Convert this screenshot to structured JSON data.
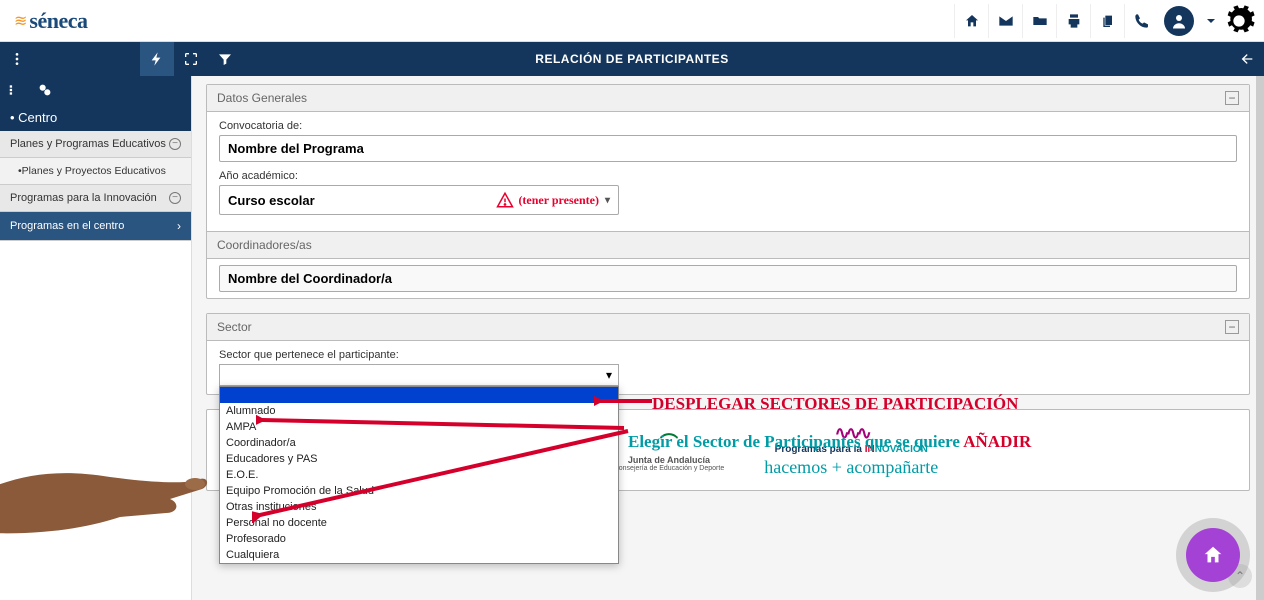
{
  "app": {
    "logo_text": "séneca"
  },
  "top_icons": {
    "home": "home-icon",
    "mail": "mail-icon",
    "folder": "folder-icon",
    "print": "print-icon",
    "copy": "copy-icon",
    "phone": "phone-icon",
    "user": "user-avatar-icon",
    "chevron": "chevron-down-icon",
    "gear": "gear-icon"
  },
  "navy": {
    "menu": "menu-icon",
    "bolt": "bolt-icon",
    "expand": "expand-icon",
    "filter": "filter-icon",
    "title": "RELACIÓN DE PARTICIPANTES",
    "back": "back-icon"
  },
  "sidebar": {
    "section_head": "• Centro",
    "items": [
      {
        "label": "Planes y Programas Educativos",
        "chev": "−",
        "type": "collapse"
      },
      {
        "label": "•Planes y Proyectos Educativos",
        "sub": true
      },
      {
        "label": "Programas para la Innovación",
        "chev": "−",
        "type": "collapse"
      },
      {
        "label": "Programas en el centro",
        "active": true,
        "chev": "›"
      }
    ]
  },
  "panels": {
    "datos": {
      "title": "Datos Generales",
      "conv_label": "Convocatoria de:",
      "conv_value": "Nombre del Programa",
      "ano_label": "Año académico:",
      "ano_value": "Curso escolar",
      "warning": "(tener presente)",
      "coord_title": "Coordinadores/as",
      "coord_value": "Nombre del Coordinador/a"
    },
    "sector": {
      "title": "Sector",
      "field_label": "Sector que pertenece el participante:",
      "options": [
        "",
        "Alumnado",
        "AMPA",
        "Coordinador/a",
        "Educadores y PAS",
        "E.O.E.",
        "Equipo Promoción de la Salud",
        "Otras instituciones",
        "Personal no docente",
        "Profesorado",
        "Cualquiera"
      ]
    }
  },
  "annotations": {
    "a1": "DESPLEGAR SECTORES DE PARTICIPACIÓN",
    "a2_pre": "Elegir el Sector de Participantes que se quiere ",
    "a2_red": "AÑADIR"
  },
  "footer": {
    "junta_top": "Junta de Andalucía",
    "junta_sub": "Consejería de Educación y Deporte",
    "prog_line1": "Programas para la",
    "prog_line2_in": "IN",
    "prog_line2_nov": "NOVACIÓN",
    "prog_cursive": "hacemos + acompañarte"
  }
}
